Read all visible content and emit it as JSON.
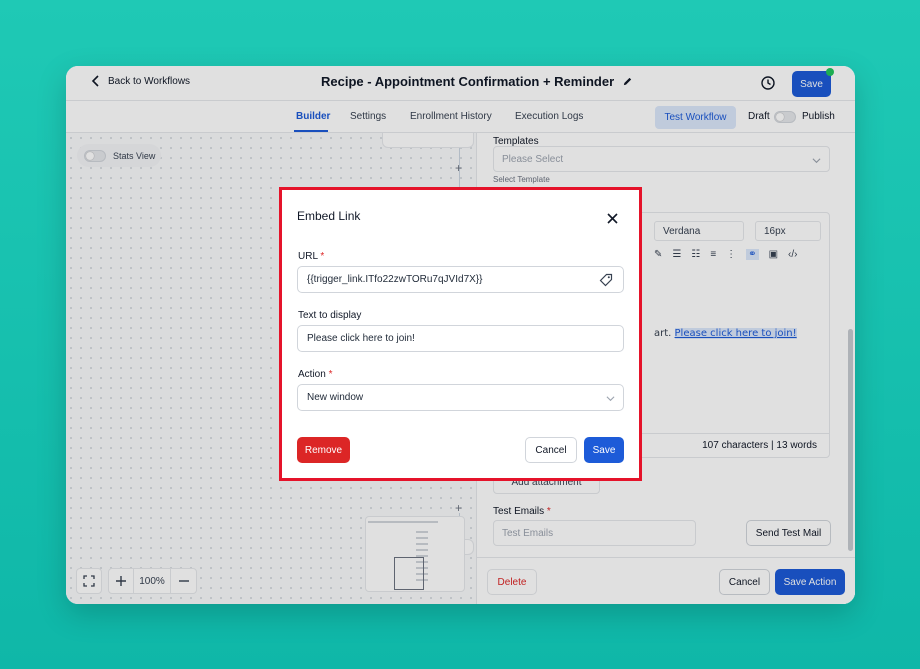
{
  "header": {
    "back_label": "Back to Workflows",
    "title": "Recipe - Appointment Confirmation + Reminder",
    "save_label": "Save"
  },
  "tabs": [
    {
      "label": "Builder",
      "active": true
    },
    {
      "label": "Settings",
      "active": false
    },
    {
      "label": "Enrollment History",
      "active": false
    },
    {
      "label": "Execution Logs",
      "active": false
    }
  ],
  "toolbar": {
    "test_workflow_label": "Test Workflow",
    "draft_label": "Draft",
    "publish_label": "Publish"
  },
  "canvas": {
    "stats_view_label": "Stats View",
    "zoom_label": "100%"
  },
  "panel": {
    "templates_label": "Templates",
    "templates_placeholder": "Please Select",
    "templates_hint": "Select Template",
    "font_family": "Verdana",
    "font_size": "16px",
    "body_text_prefix": "art. ",
    "body_link_text": "Please click here to join!",
    "char_count": "107 characters | 13 words",
    "add_attachment_label": "Add attachment",
    "test_emails_label": "Test Emails",
    "test_emails_placeholder": "Test Emails",
    "send_test_mail_label": "Send Test Mail",
    "delete_label": "Delete",
    "cancel_label": "Cancel",
    "save_action_label": "Save Action"
  },
  "modal": {
    "title": "Embed Link",
    "url_label": "URL",
    "url_value": "{{trigger_link.ITfo22zwTORu7qJVId7X}}",
    "text_label": "Text to display",
    "text_value": "Please click here to join!",
    "action_label": "Action",
    "action_value": "New window",
    "remove_label": "Remove",
    "cancel_label": "Cancel",
    "save_label": "Save"
  },
  "colors": {
    "background": "#12bfae",
    "primary": "#1d5bd8",
    "danger": "#dc2626",
    "highlight_border": "#e5132a"
  }
}
